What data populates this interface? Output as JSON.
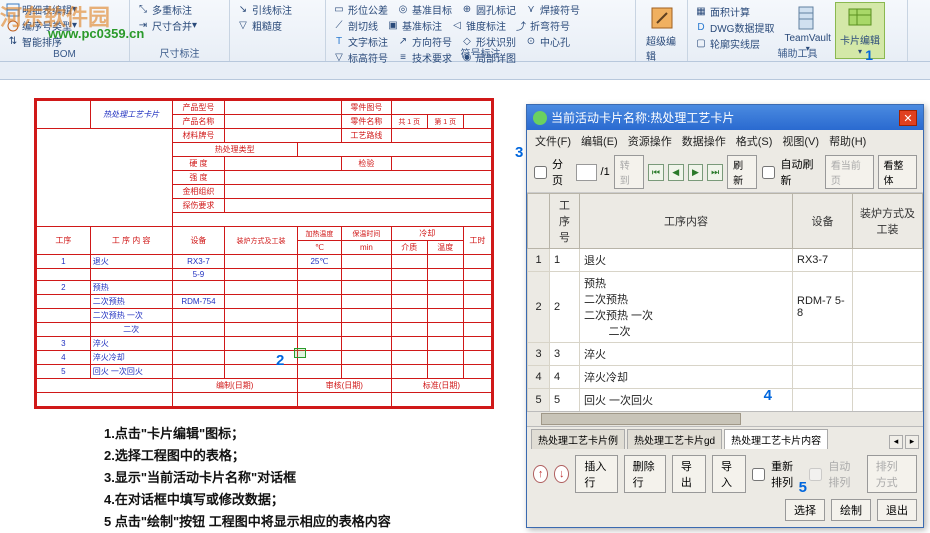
{
  "watermark": {
    "brand": "河东软件园",
    "url": "www.pc0359.cn"
  },
  "ribbon": {
    "groups": [
      {
        "label": "BOM",
        "items": [
          "明细表编辑",
          "编序号类型",
          "智能排序"
        ]
      },
      {
        "label": "尺寸标注",
        "items": [
          "多重标注",
          "尺寸合并"
        ]
      },
      {
        "label": "",
        "items": [
          "引线标注",
          "粗糙度"
        ]
      },
      {
        "label": "符号标注",
        "items": [
          "形位公差",
          "基准标注",
          "形状识别",
          "基准目标",
          "锥度标注",
          "中心孔",
          "圆孔标记",
          "折弯符号",
          "标高符号",
          "焊接符号",
          "文字标注",
          "技术要求",
          "剖切线",
          "方向符号",
          "局部详图"
        ]
      },
      {
        "label": "",
        "big": [
          {
            "label": "超级编辑"
          }
        ]
      },
      {
        "label": "辅助工具",
        "items": [
          "面积计算",
          "DWG数据提取",
          "轮廓实线层"
        ],
        "big": [
          {
            "label": "TeamVault"
          },
          {
            "label": "卡片编辑",
            "highlight": true
          }
        ]
      }
    ]
  },
  "badges": {
    "n1": "1",
    "n2": "2",
    "n3": "3",
    "n4": "4",
    "n5": "5"
  },
  "card": {
    "title": "热处理工艺卡片",
    "header_labels": [
      "产品型号",
      "零件图号",
      "产品名称",
      "零件名称",
      "共",
      "页",
      "第",
      "页"
    ],
    "mid_labels": [
      "材料牌号",
      "工艺路线",
      "热处理类型",
      "硬 度",
      "强 度",
      "金相组织",
      "探伤要求"
    ],
    "proc_header": [
      "工序",
      "工 序 内 容",
      "设备",
      "装炉方式及工装",
      "加热温度",
      "保温时间",
      "冷却",
      "工时"
    ],
    "proc_sub": [
      "℃",
      "min",
      "介质",
      "温度"
    ],
    "rows": [
      {
        "n": "1",
        "name": "退火",
        "dev": "RX3-7",
        "temp": "25℃"
      },
      {
        "n": "",
        "name": "",
        "dev": "5-9",
        "temp": ""
      },
      {
        "n": "2",
        "name": "预热",
        "dev": "",
        "temp": ""
      },
      {
        "n": "",
        "name": "二次预热",
        "dev": "RDM-754",
        "temp": ""
      },
      {
        "n": "",
        "name": "二次预热 一次",
        "dev": "",
        "temp": ""
      },
      {
        "n": "",
        "name": "二次",
        "dev": "",
        "temp": ""
      },
      {
        "n": "3",
        "name": "淬火",
        "dev": "",
        "temp": ""
      },
      {
        "n": "4",
        "name": "淬火冷却",
        "dev": "",
        "temp": ""
      },
      {
        "n": "5",
        "name": "回火 一次回火",
        "dev": "",
        "temp": ""
      }
    ],
    "footer": [
      "编制(日期)",
      "审核(日期)",
      "标准(日期)"
    ]
  },
  "instructions": [
    "1.点击\"卡片编辑\"图标；",
    "2.选择工程图中的表格；",
    "3.显示\"当前活动卡片名称\"对话框",
    "4.在对话框中填写或修改数据；",
    "5 点击\"绘制\"按钮 工程图中将显示相应的表格内容"
  ],
  "dialog": {
    "title_prefix": "当前活动卡片名称:",
    "title_name": "热处理工艺卡片",
    "menu": [
      "文件(F)",
      "编辑(E)",
      "资源操作",
      "数据操作",
      "格式(S)",
      "视图(V)",
      "帮助(H)"
    ],
    "toolbar": {
      "paged": "分页",
      "page_total": "/1",
      "goto": "转到",
      "refresh": "刷新",
      "auto_refresh": "自动刷新",
      "view_current": "看当前页",
      "view_all": "看整体"
    },
    "grid": {
      "cols": [
        "工序号",
        "工序内容",
        "设备",
        "装炉方式及工装"
      ],
      "rows": [
        {
          "i": "1",
          "seq": "1",
          "content": "退火",
          "dev": "RX3-7"
        },
        {
          "i": "2",
          "seq": "2",
          "content": "预热\n二次预热\n二次预热 一次\n        二次",
          "dev": "RDM-7 5-8"
        },
        {
          "i": "3",
          "seq": "3",
          "content": "淬火",
          "dev": ""
        },
        {
          "i": "4",
          "seq": "4",
          "content": "淬火冷却",
          "dev": ""
        },
        {
          "i": "5",
          "seq": "5",
          "content": "回火 一次回火",
          "dev": ""
        }
      ]
    },
    "tabs": [
      "热处理工艺卡片例",
      "热处理工艺卡片gd",
      "热处理工艺卡片内容"
    ],
    "footer": {
      "insert": "插入行",
      "delete": "删除行",
      "export": "导出",
      "import": "导入",
      "resort": "重新排列",
      "autosort": "自动排列",
      "sort_mode": "排列方式",
      "select": "选择",
      "draw": "绘制",
      "exit": "退出"
    }
  }
}
